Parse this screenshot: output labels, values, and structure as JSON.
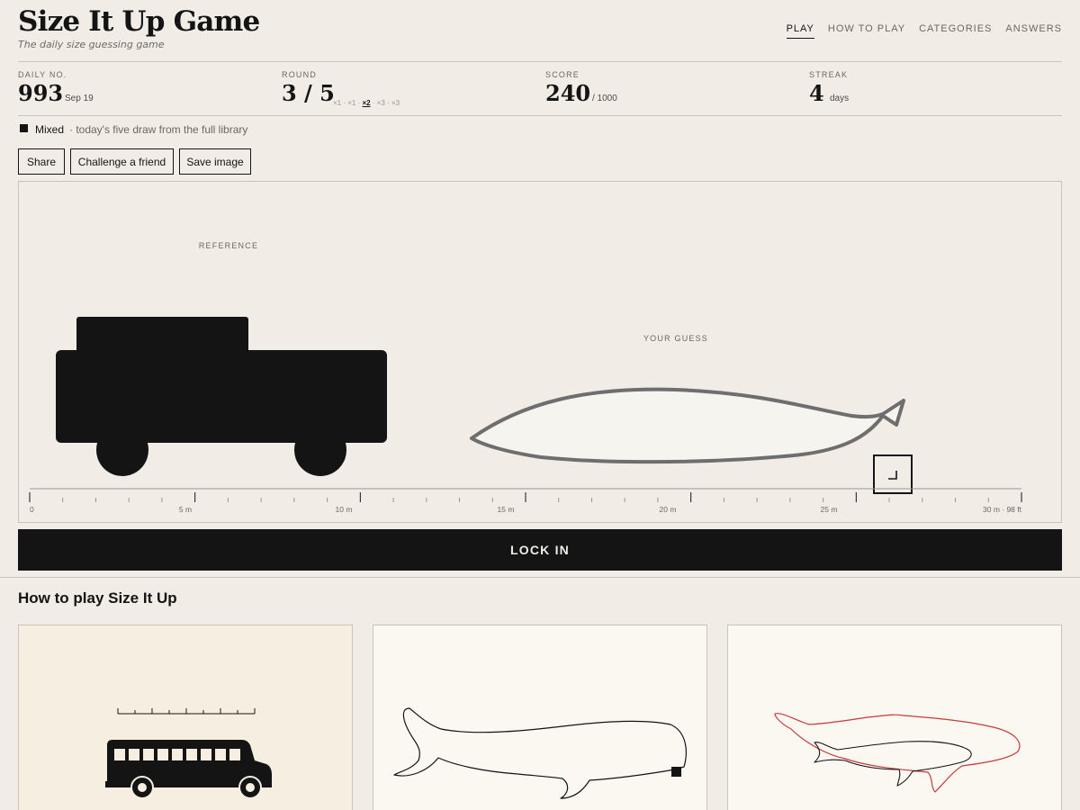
{
  "header": {
    "title": "Size It Up Game",
    "subtitle": "The daily size guessing game",
    "nav": [
      {
        "label": "PLAY",
        "active": true
      },
      {
        "label": "HOW TO PLAY",
        "active": false
      },
      {
        "label": "CATEGORIES",
        "active": false
      },
      {
        "label": "ANSWERS",
        "active": false
      }
    ]
  },
  "stats": {
    "daily": {
      "label": "DAILY NO.",
      "value": "993",
      "sub": "Sep 19"
    },
    "round": {
      "label": "ROUND",
      "value": "3 / 5",
      "pips": [
        "×1",
        "×1",
        "×2",
        "×3",
        "×3"
      ],
      "current_index": 2
    },
    "score": {
      "label": "SCORE",
      "value": "240",
      "sub": "/ 1000"
    },
    "streak": {
      "label": "STREAK",
      "value": "4",
      "sub": "days"
    }
  },
  "mode": {
    "label": "Mixed",
    "note": "· today's five draw from the full library"
  },
  "buttons": {
    "share": "Share",
    "challenge": "Challenge a friend",
    "save": "Save image"
  },
  "stage": {
    "reference_label": "REFERENCE",
    "guess_label": "YOUR GUESS",
    "scale": {
      "tick_labels": [
        "0",
        "5 m",
        "10 m",
        "15 m",
        "20 m",
        "25 m",
        "30 m · 98 ft"
      ],
      "max_m": 30
    },
    "reference_icon": "truck-silhouette",
    "guess_icon": "whale-outline",
    "resize_handle_icon": "resize-handle-icon"
  },
  "lock_in": "LOCK IN",
  "howto": {
    "title": "How to play Size It Up",
    "cards": [
      {
        "icon": "school-bus-ruler-illustration"
      },
      {
        "icon": "whale-resize-illustration"
      },
      {
        "icon": "whale-comparison-illustration"
      }
    ]
  },
  "colors": {
    "background": "#f1ede6",
    "ink": "#141414",
    "muted": "#6b6761",
    "guess_stroke": "#6e6e6e",
    "guess_fill": "#f6f4ee",
    "answer_outline": "#c8393b"
  }
}
